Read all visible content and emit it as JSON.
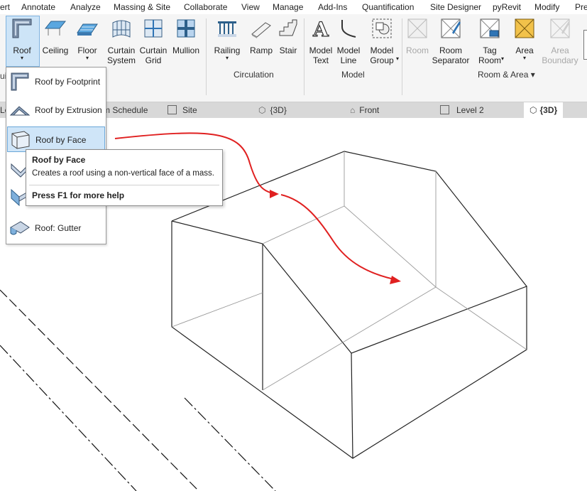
{
  "menubar": {
    "items": [
      "ert",
      "Annotate",
      "Analyze",
      "Massing & Site",
      "Collaborate",
      "View",
      "Manage",
      "Add-Ins",
      "Quantification",
      "Site Designer",
      "pyRevit",
      "Modify",
      "Pre"
    ]
  },
  "ribbon": {
    "build_tools": [
      {
        "label": "Roof",
        "icon": "roof-icon"
      },
      {
        "label": "Ceiling",
        "icon": "ceiling-icon"
      },
      {
        "label": "Floor",
        "icon": "floor-icon"
      },
      {
        "label": "Curtain\nSystem",
        "icon": "curtain-system-icon"
      },
      {
        "label": "Curtain\nGrid",
        "icon": "curtain-grid-icon"
      },
      {
        "label": "Mullion",
        "icon": "mullion-icon"
      }
    ],
    "circulation_tools": [
      {
        "label": "Railing",
        "icon": "railing-icon"
      },
      {
        "label": "Ramp",
        "icon": "ramp-icon"
      },
      {
        "label": "Stair",
        "icon": "stair-icon"
      }
    ],
    "model_tools": [
      {
        "label": "Model\nText",
        "icon": "model-text-icon"
      },
      {
        "label": "Model\nLine",
        "icon": "model-line-icon"
      },
      {
        "label": "Model\nGroup",
        "icon": "model-group-icon"
      }
    ],
    "room_tools": [
      {
        "label": "Room",
        "icon": "room-icon",
        "disabled": true
      },
      {
        "label": "Room\nSeparator",
        "icon": "room-separator-icon"
      },
      {
        "label": "Tag\nRoom",
        "icon": "tag-room-icon"
      },
      {
        "label": "Area",
        "icon": "area-icon"
      },
      {
        "label": "Area\nBoundary",
        "icon": "area-boundary-icon",
        "disabled": true
      }
    ],
    "panels": {
      "circulation": "Circulation",
      "model": "Model",
      "room_area": "Room & Area ▾"
    },
    "build_partial": "ui"
  },
  "view_tabs": [
    "Le",
    "m Schedule",
    "Site",
    "{3D}",
    "Front",
    "Level 2",
    "{3D}"
  ],
  "roof_menu": {
    "items": [
      {
        "label": "Roof by Footprint",
        "icon": "roof-footprint-icon"
      },
      {
        "label": "Roof by Extrusion",
        "icon": "roof-extrusion-icon"
      },
      {
        "label": "Roof by Face",
        "icon": "roof-face-icon",
        "highlighted": true
      },
      {
        "label": "",
        "icon": "roof-soffit-icon"
      },
      {
        "label": "",
        "icon": "roof-fascia-icon"
      },
      {
        "label": "Roof: Gutter",
        "icon": "roof-gutter-icon"
      }
    ]
  },
  "tooltip": {
    "title": "Roof by Face",
    "description": "Creates a roof using a non-vertical face of a mass.",
    "help": "Press F1 for more help"
  },
  "colors": {
    "arrow": "#e02020",
    "highlight": "#cfe5f8",
    "ribbon_bg": "#f5f5f5",
    "tab_bar": "#d8d8d8"
  }
}
